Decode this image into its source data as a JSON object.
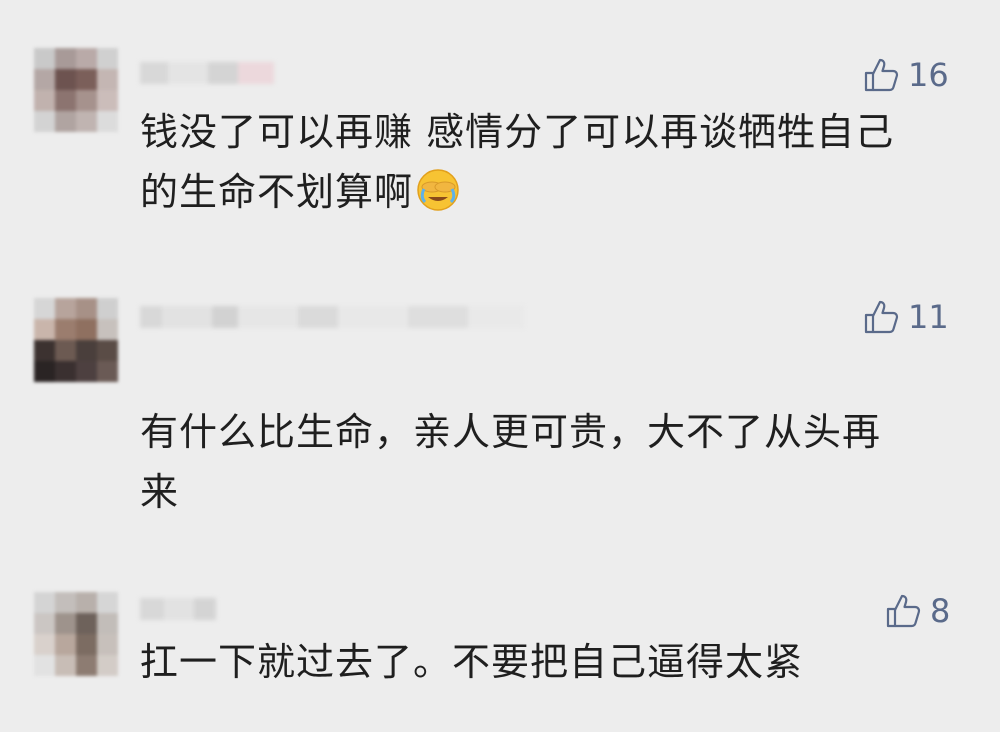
{
  "comments": [
    {
      "likes": "16",
      "text_lines": [
        "钱没了可以再赚 感情分了可以再谈牺牲自己",
        "的生命不划算啊"
      ],
      "emoji": "face-palm-crying-emoji"
    },
    {
      "likes": "11",
      "text_lines": [
        "有什么比生命，亲人更可贵，大不了从头再",
        "来"
      ]
    },
    {
      "likes": "8",
      "text_lines": [
        "扛一下就过去了。不要把自己逼得太紧"
      ]
    }
  ],
  "colors": {
    "background": "#ededed",
    "like_color": "#5a6a8a",
    "text": "#1f1f1f"
  },
  "icons": {
    "like": "thumbs-up-icon",
    "avatar": "blurred-avatar"
  }
}
